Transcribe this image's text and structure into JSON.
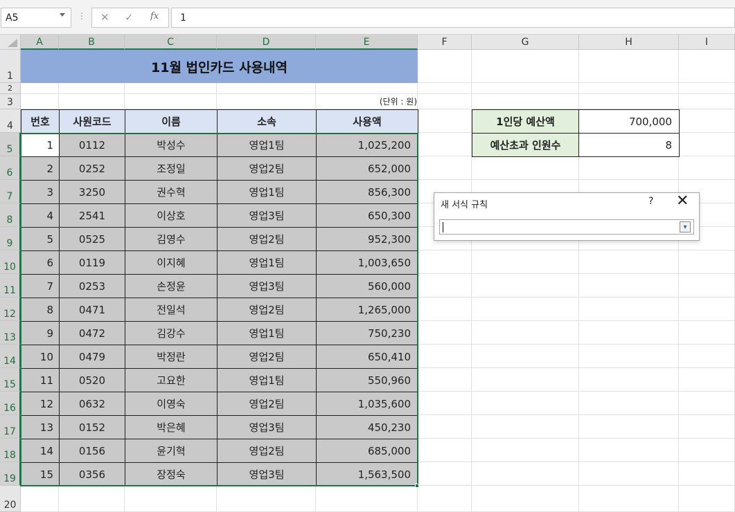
{
  "formula_bar": {
    "name_box": "A5",
    "cancel_icon": "✕",
    "enter_icon": "✓",
    "fx_label": "fx",
    "formula": "1"
  },
  "columns": [
    "A",
    "B",
    "C",
    "D",
    "E",
    "F",
    "G",
    "H",
    "I"
  ],
  "rows": [
    "1",
    "2",
    "3",
    "4",
    "5",
    "6",
    "7",
    "8",
    "9",
    "10",
    "11",
    "12",
    "13",
    "14",
    "15",
    "16",
    "17",
    "18",
    "19",
    "20"
  ],
  "sheet": {
    "title": "11월 법인카드 사용내역",
    "unit_note": "(단위 : 원)",
    "headers": [
      "번호",
      "사원코드",
      "이름",
      "소속",
      "사용액"
    ],
    "records": [
      [
        "1",
        "0112",
        "박성수",
        "영업1팀",
        "1,025,200"
      ],
      [
        "2",
        "0252",
        "조정일",
        "영업2팀",
        "652,000"
      ],
      [
        "3",
        "3250",
        "권수혁",
        "영업1팀",
        "856,300"
      ],
      [
        "4",
        "2541",
        "이상호",
        "영업3팀",
        "650,300"
      ],
      [
        "5",
        "0525",
        "김영수",
        "영업2팀",
        "952,300"
      ],
      [
        "6",
        "0119",
        "이지혜",
        "영업1팀",
        "1,003,650"
      ],
      [
        "7",
        "0253",
        "손정윤",
        "영업3팀",
        "560,000"
      ],
      [
        "8",
        "0471",
        "전일석",
        "영업2팀",
        "1,265,000"
      ],
      [
        "9",
        "0472",
        "김강수",
        "영업1팀",
        "750,230"
      ],
      [
        "10",
        "0479",
        "박정란",
        "영업2팀",
        "650,410"
      ],
      [
        "11",
        "0520",
        "고요한",
        "영업1팀",
        "550,960"
      ],
      [
        "12",
        "0632",
        "이영숙",
        "영업2팀",
        "1,035,600"
      ],
      [
        "13",
        "0152",
        "박은혜",
        "영업3팀",
        "450,230"
      ],
      [
        "14",
        "0156",
        "윤기혁",
        "영업2팀",
        "685,000"
      ],
      [
        "15",
        "0356",
        "장정숙",
        "영업3팀",
        "1,563,500"
      ]
    ]
  },
  "side": {
    "budget_label": "1인당 예산액",
    "budget_value": "700,000",
    "over_label": "예산초과 인원수",
    "over_value": "8"
  },
  "dialog": {
    "title": "새 서식 규칙",
    "help": "?",
    "close": "✕",
    "collapse_icon": "▾"
  },
  "colors": {
    "title_fill": "#8eaadb",
    "header_fill": "#dae3f3",
    "data_fill": "#c9c9c9",
    "side_label_fill": "#e2efda",
    "selection": "#217346"
  }
}
